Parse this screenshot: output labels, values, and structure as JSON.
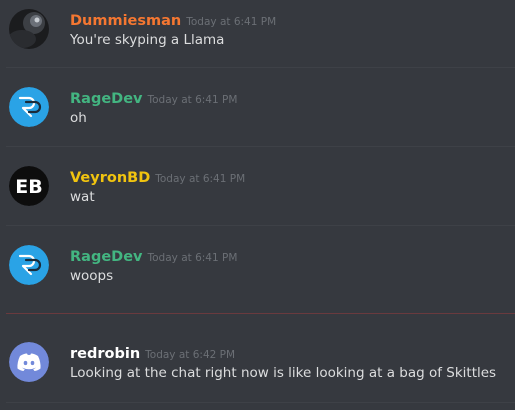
{
  "messages": [
    {
      "author": "Dummiesman",
      "author_color": "#f57731",
      "timestamp": "Today at 6:41 PM",
      "text": "You're skyping a Llama",
      "avatar": "dark-photo-avatar"
    },
    {
      "author": "RageDev",
      "author_color": "#43b581",
      "timestamp": "Today at 6:41 PM",
      "text": "oh",
      "avatar": "rp-logo-avatar"
    },
    {
      "author": "VeyronBD",
      "author_color": "#f1c40f",
      "timestamp": "Today at 6:41 PM",
      "text": "wat",
      "avatar": "eb-logo-avatar",
      "avatar_text": "EB"
    },
    {
      "author": "RageDev",
      "author_color": "#43b581",
      "timestamp": "Today at 6:41 PM",
      "text": "woops",
      "avatar": "rp-logo-avatar"
    },
    {
      "author": "redrobin",
      "author_color": "#ffffff",
      "timestamp": "Today at 6:42 PM",
      "text": "Looking at the chat right now is like looking at a bag of Skittles",
      "avatar": "discord-logo-avatar"
    }
  ],
  "colors": {
    "background": "#36393f",
    "divider": "#3e4147",
    "new_messages_divider": "#6a3a3e",
    "ragedev_avatar": "#2aa3e6",
    "discord_avatar": "#7289da"
  }
}
